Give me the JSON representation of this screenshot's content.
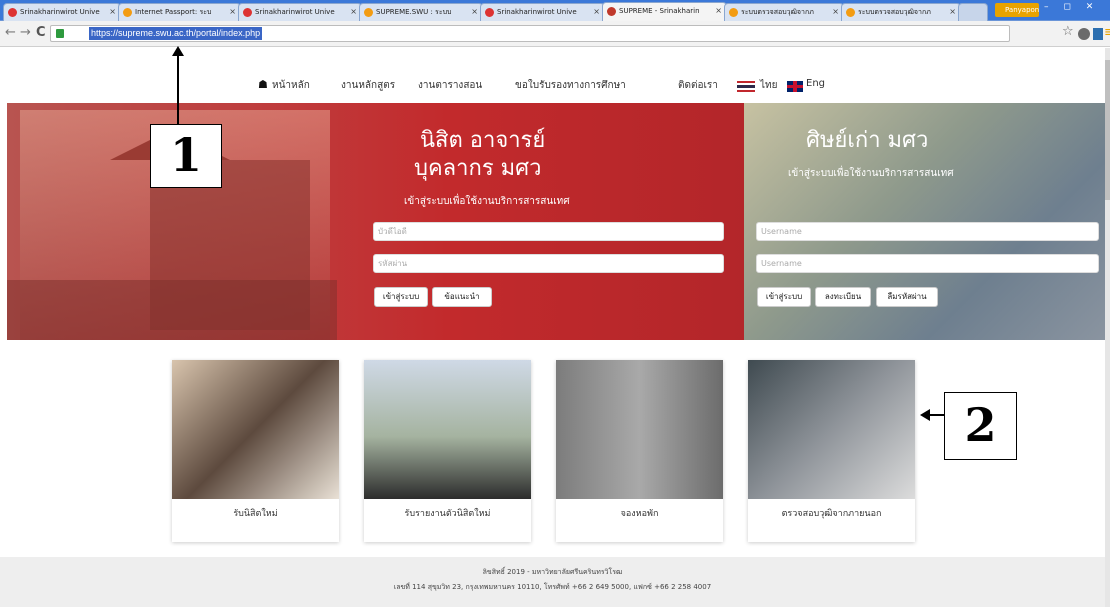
{
  "browser": {
    "tabs": [
      {
        "title": "Srinakharinwirot Unive"
      },
      {
        "title": "Internet Passport: ระบ"
      },
      {
        "title": "Srinakharinwirot Unive"
      },
      {
        "title": "SUPREME.SWU : ระบบ"
      },
      {
        "title": "Srinakharinwirot Unive"
      },
      {
        "title": "SUPREME - Srinakharin"
      },
      {
        "title": "ระบบตรวจสอบวุฒิจากภ"
      },
      {
        "title": "ระบบตรวจสอบวุฒิจากภ"
      }
    ],
    "tab_close": "×",
    "profile_name": "Panyapon",
    "window_buttons": "– ◻ ✕",
    "nav": {
      "back": "←",
      "forward": "→",
      "reload": "C"
    },
    "url": "https://supreme.swu.ac.th/portal/index.php",
    "star": "☆",
    "menu": "≡"
  },
  "site": {
    "nav": {
      "home": "หน้าหลัก",
      "curriculum": "งานหลักสูตร",
      "schedule": "งานตารางสอน",
      "certificate": "ขอใบรับรองทางการศึกษา",
      "contact": "ติดต่อเรา",
      "thai": "ไทย",
      "eng": "Eng"
    },
    "home_icon": "home-icon",
    "staff": {
      "title_line1": "นิสิต อาจารย์",
      "title_line2": "บุคลากร มศว",
      "subtitle": "เข้าสู่ระบบเพื่อใช้งานบริการสารสนเทศ",
      "userid_placeholder": "บัวดีไอดี",
      "password_placeholder": "รหัสผ่าน",
      "login_button": "เข้าสู่ระบบ",
      "advice_button": "ข้อแนะนำ"
    },
    "alumni": {
      "title": "ศิษย์เก่า มศว",
      "subtitle": "เข้าสู่ระบบเพื่อใช้งานบริการสารสนเทศ",
      "username_placeholder": "Username",
      "password_placeholder": "Username",
      "login_button": "เข้าสู่ระบบ",
      "register_button": "ลงทะเบียน",
      "forgot_button": "ลืมรหัสผ่าน"
    },
    "cards": [
      {
        "label": "รับนิสิตใหม่"
      },
      {
        "label": "รับรายงานตัวนิสิตใหม่"
      },
      {
        "label": "จองหอพัก"
      },
      {
        "label": "ตรวจสอบวุฒิจากภายนอก"
      }
    ],
    "footer": {
      "line1": "ลิขสิทธิ์ 2019 - มหาวิทยาลัยศรีนครินทรวิโรฒ",
      "line2": "เลขที่ 114 สุขุมวิท 23, กรุงเทพมหานคร 10110, โทรศัพท์ +66 2 649 5000, แฟกซ์ +66 2 258 4007"
    }
  },
  "annotations": {
    "label1": "1",
    "label2": "2"
  }
}
